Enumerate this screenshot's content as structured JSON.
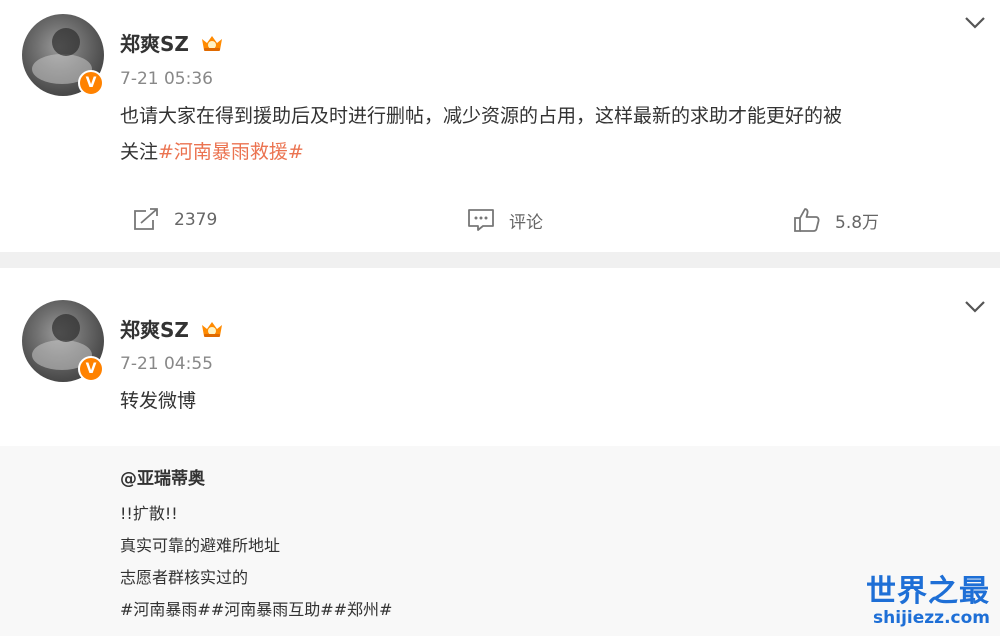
{
  "posts": [
    {
      "author": "郑爽SZ",
      "time": "7-21 05:36",
      "text_line1": "也请大家在得到援助后及时进行删帖，减少资源的占用，这样最新的求助才能更好的被",
      "text_line2_prefix": "关注",
      "text_topic": "#河南暴雨救援#",
      "repost_count": "2379",
      "comment_label": "评论",
      "like_count": "5.8万"
    },
    {
      "author": "郑爽SZ",
      "time": "7-21 04:55",
      "text": "转发微博",
      "repost": {
        "author": "@亚瑞蒂奥",
        "line1": "!!扩散!!",
        "line2": "真实可靠的避难所地址",
        "line3": "志愿者群核实过的",
        "topics": "#河南暴雨##河南暴雨互助##郑州#"
      }
    }
  ],
  "watermark": {
    "title": "世界之最",
    "url": "shijiezz.com"
  },
  "colors": {
    "accent_topic": "#eb7350",
    "verified_orange": "#ff8200",
    "watermark_blue": "#1e6fd6"
  },
  "icons": [
    "verified-v-icon",
    "crown-badge-icon",
    "chevron-down-icon",
    "repost-icon",
    "comment-icon",
    "like-icon"
  ]
}
